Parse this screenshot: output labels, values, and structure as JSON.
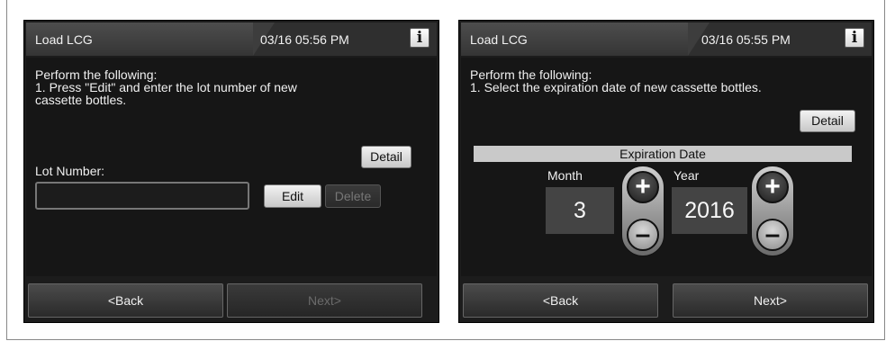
{
  "screens": [
    {
      "title": "Load LCG",
      "datetime": "03/16 05:56 PM",
      "info_icon": "i",
      "instructions": [
        "Perform the following:",
        "1. Press \"Edit\" and enter the lot number of new",
        "cassette bottles."
      ],
      "detail_label": "Detail",
      "lot_label": "Lot Number:",
      "lot_value": "",
      "edit_label": "Edit",
      "delete_label": "Delete",
      "back_label": "<Back",
      "next_label": "Next>"
    },
    {
      "title": "Load LCG",
      "datetime": "03/16 05:55 PM",
      "info_icon": "i",
      "instructions": [
        "Perform the following:",
        "1. Select the expiration date of new cassette bottles."
      ],
      "detail_label": "Detail",
      "expiration_header": "Expiration Date",
      "month_label": "Month",
      "month_value": "3",
      "year_label": "Year",
      "year_value": "2016",
      "plus_icon": "+",
      "minus_icon": "–",
      "back_label": "<Back",
      "next_label": "Next>"
    }
  ]
}
